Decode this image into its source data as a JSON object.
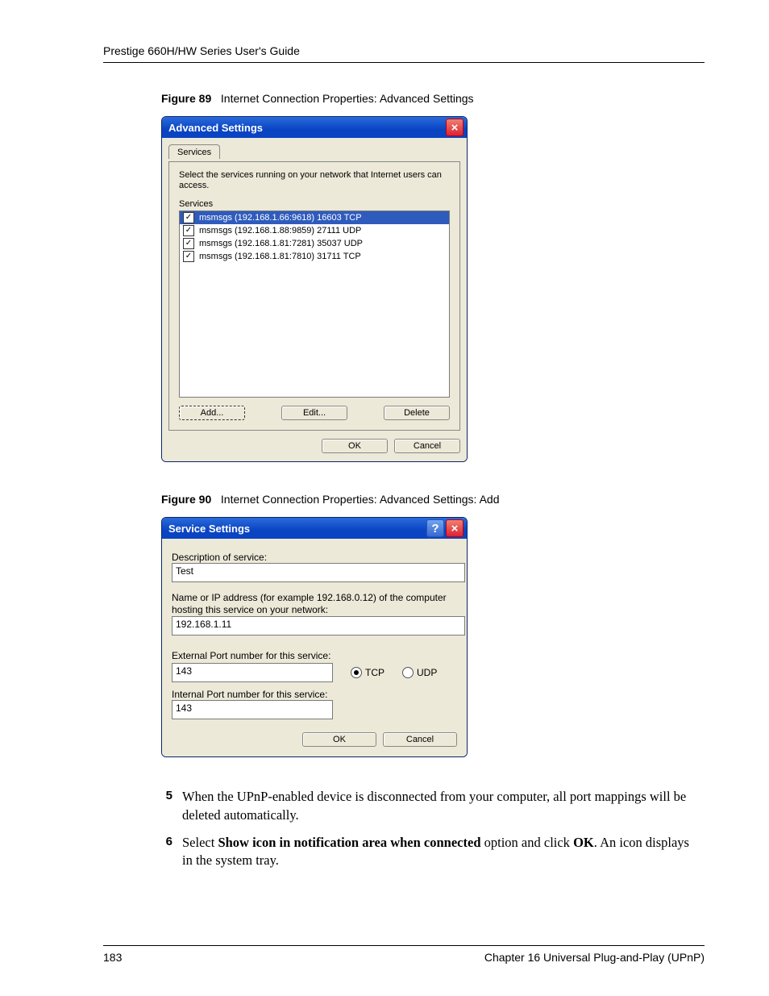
{
  "doc_header": "Prestige 660H/HW Series User's Guide",
  "fig89": {
    "caption_num": "Figure 89",
    "caption_text": "Internet Connection Properties: Advanced Settings",
    "title": "Advanced Settings",
    "tab": "Services",
    "instruction": "Select the services running on your network that Internet users can access.",
    "group_label": "Services",
    "items": [
      {
        "checked": true,
        "selected": true,
        "label": "msmsgs (192.168.1.66:9618) 16603 TCP"
      },
      {
        "checked": true,
        "selected": false,
        "label": "msmsgs (192.168.1.88:9859) 27111 UDP"
      },
      {
        "checked": true,
        "selected": false,
        "label": "msmsgs (192.168.1.81:7281) 35037 UDP"
      },
      {
        "checked": true,
        "selected": false,
        "label": "msmsgs (192.168.1.81:7810) 31711 TCP"
      }
    ],
    "btn_add": "Add...",
    "btn_edit": "Edit...",
    "btn_delete": "Delete",
    "btn_ok": "OK",
    "btn_cancel": "Cancel"
  },
  "fig90": {
    "caption_num": "Figure 90",
    "caption_text": "Internet Connection Properties: Advanced Settings: Add",
    "title": "Service Settings",
    "desc_label": "Description of service:",
    "desc_value": "Test",
    "ip_label": "Name or IP address (for example 192.168.0.12) of the computer hosting this service on your network:",
    "ip_value": "192.168.1.11",
    "ext_label": "External Port number for this service:",
    "ext_value": "143",
    "proto_tcp": "TCP",
    "proto_udp": "UDP",
    "proto_selected": "TCP",
    "int_label": "Internal Port number for this service:",
    "int_value": "143",
    "btn_ok": "OK",
    "btn_cancel": "Cancel"
  },
  "steps": {
    "s5_num": "5",
    "s5_text": "When the UPnP-enabled device is disconnected from your computer, all port mappings will be deleted automatically.",
    "s6_num": "6",
    "s6_pre": "Select ",
    "s6_bold1": "Show icon in notification area when connected",
    "s6_mid": " option and click ",
    "s6_bold2": "OK",
    "s6_post": ". An icon displays in the system tray."
  },
  "footer": {
    "page_num": "183",
    "chapter": "Chapter 16 Universal Plug-and-Play (UPnP)"
  }
}
